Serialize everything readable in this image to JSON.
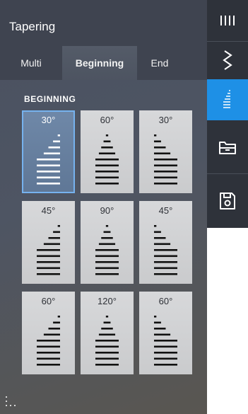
{
  "panel": {
    "title": "Tapering",
    "tabs": [
      {
        "label": "Multi",
        "active": false
      },
      {
        "label": "Beginning",
        "active": true
      },
      {
        "label": "End",
        "active": false
      }
    ],
    "section_label": "BEGINNING"
  },
  "tiles": [
    {
      "angle": "30°",
      "shape": "left",
      "selected": true
    },
    {
      "angle": "60°",
      "shape": "center",
      "selected": false
    },
    {
      "angle": "30°",
      "shape": "right",
      "selected": false
    },
    {
      "angle": "45°",
      "shape": "left",
      "selected": false
    },
    {
      "angle": "90°",
      "shape": "center",
      "selected": false
    },
    {
      "angle": "45°",
      "shape": "right",
      "selected": false
    },
    {
      "angle": "60°",
      "shape": "left",
      "selected": false
    },
    {
      "angle": "120°",
      "shape": "center",
      "selected": false
    },
    {
      "angle": "60°",
      "shape": "right",
      "selected": false
    }
  ],
  "rail": {
    "items": [
      {
        "icon": "stitch-bars-icon",
        "active": false
      },
      {
        "icon": "zigzag-stitch-icon",
        "active": false
      },
      {
        "icon": "tapering-icon",
        "active": true
      },
      {
        "icon": "folder-icon",
        "active": false
      },
      {
        "icon": "save-icon",
        "active": false
      }
    ]
  },
  "colors": {
    "accent": "#1e90e6",
    "selected_tile": "#6f88a8",
    "panel": "#4b5260",
    "rail": "#2e323a"
  }
}
